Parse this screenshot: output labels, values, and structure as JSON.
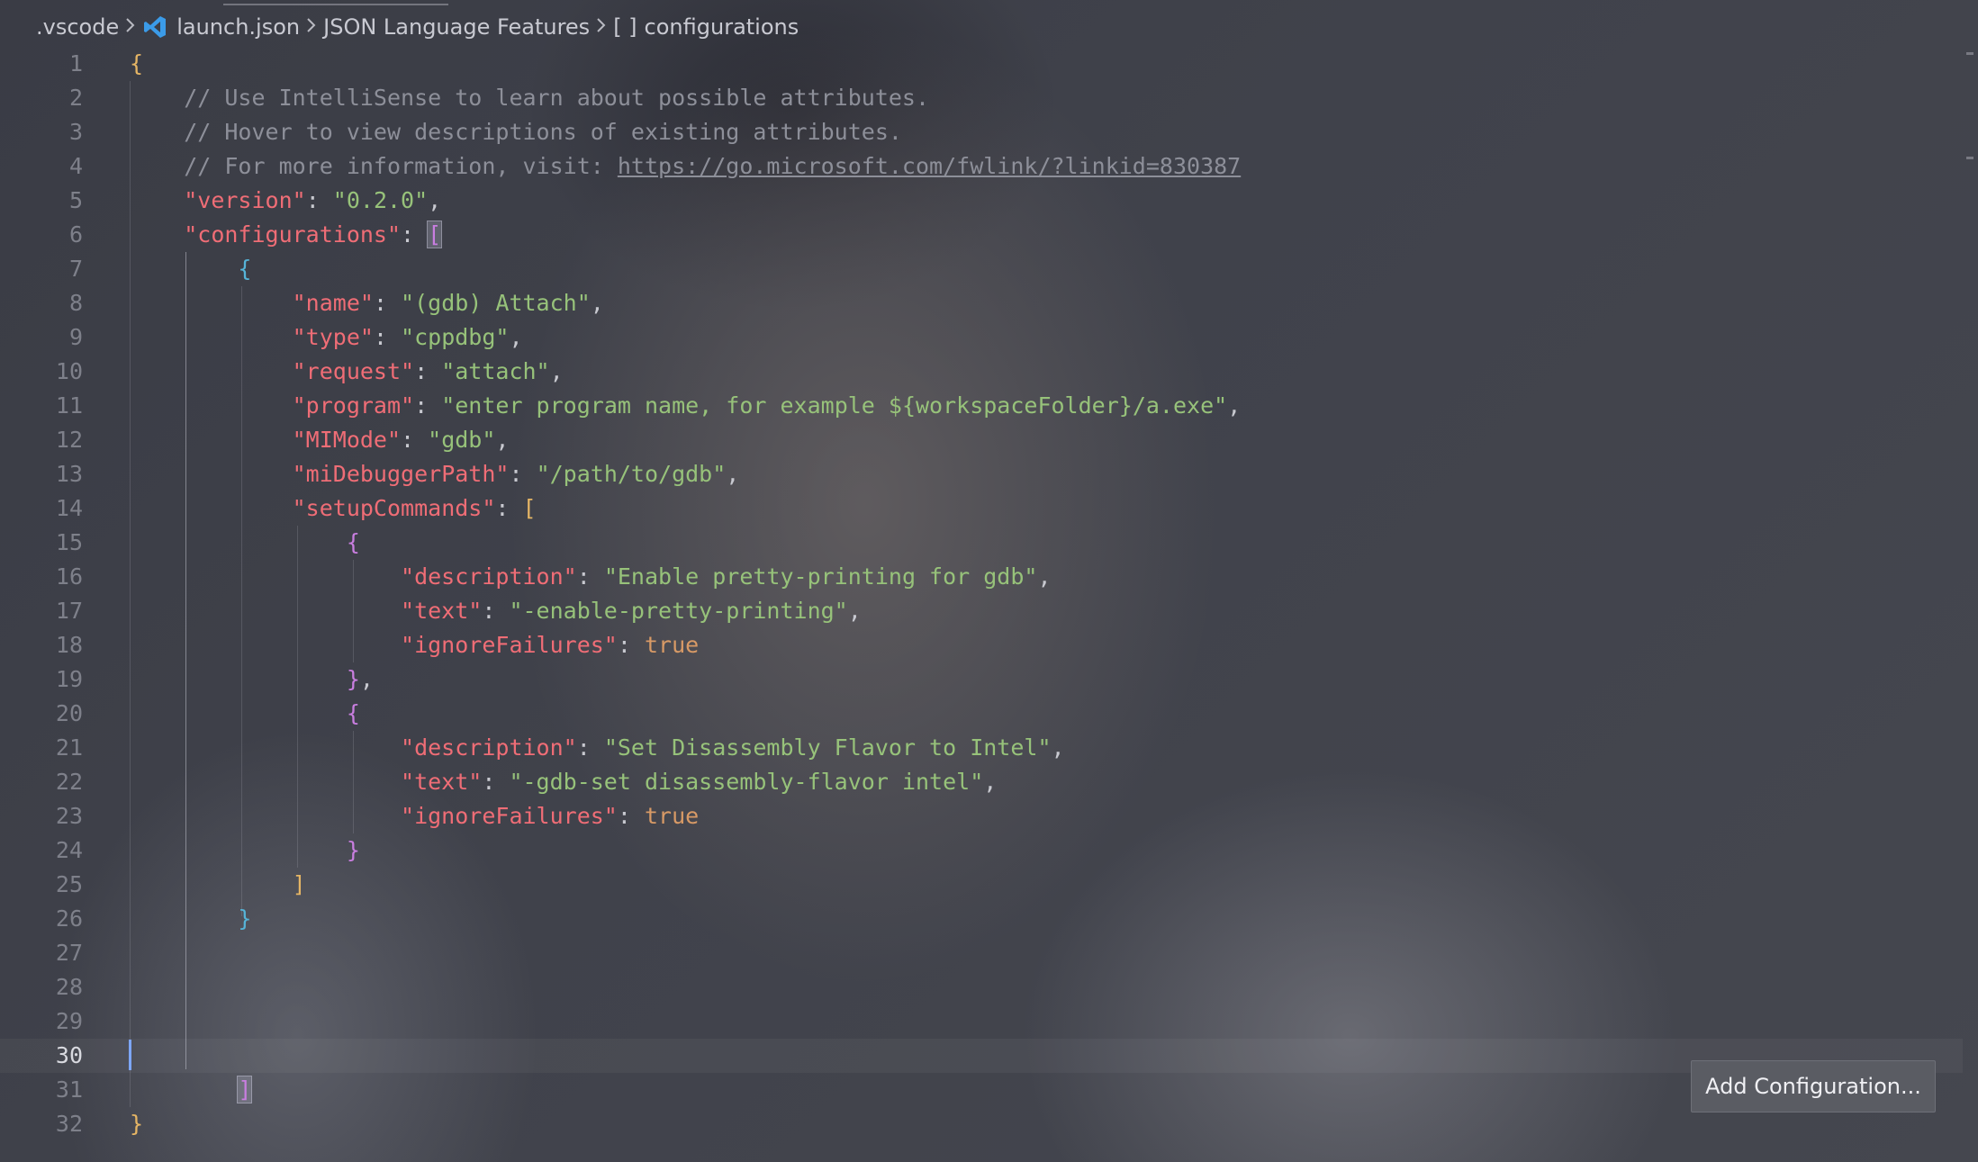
{
  "breadcrumb": {
    "folder": ".vscode",
    "file": "launch.json",
    "feature": "JSON Language Features",
    "symbol_icon": "[ ]",
    "symbol": "configurations"
  },
  "icons": {
    "file_icon": "vscode-logo-icon",
    "chevron": "chevron-right-icon"
  },
  "editor": {
    "current_line": 30,
    "lines": [
      {
        "n": "1"
      },
      {
        "n": "2",
        "comment": "// Use IntelliSense to learn about possible attributes."
      },
      {
        "n": "3",
        "comment": "// Hover to view descriptions of existing attributes."
      },
      {
        "n": "4",
        "comment": "// For more information, visit: ",
        "link": "https://go.microsoft.com/fwlink/?linkid=830387"
      },
      {
        "n": "5",
        "key": "\"version\"",
        "value": "\"0.2.0\""
      },
      {
        "n": "6",
        "key": "\"configurations\""
      },
      {
        "n": "7"
      },
      {
        "n": "8",
        "key": "\"name\"",
        "value": "\"(gdb) Attach\""
      },
      {
        "n": "9",
        "key": "\"type\"",
        "value": "\"cppdbg\""
      },
      {
        "n": "10",
        "key": "\"request\"",
        "value": "\"attach\""
      },
      {
        "n": "11",
        "key": "\"program\"",
        "value": "\"enter program name, for example ${workspaceFolder}/a.exe\""
      },
      {
        "n": "12",
        "key": "\"MIMode\"",
        "value": "\"gdb\""
      },
      {
        "n": "13",
        "key": "\"miDebuggerPath\"",
        "value": "\"/path/to/gdb\""
      },
      {
        "n": "14",
        "key": "\"setupCommands\""
      },
      {
        "n": "15"
      },
      {
        "n": "16",
        "key": "\"description\"",
        "value": "\"Enable pretty-printing for gdb\""
      },
      {
        "n": "17",
        "key": "\"text\"",
        "value": "\"-enable-pretty-printing\""
      },
      {
        "n": "18",
        "key": "\"ignoreFailures\"",
        "value": "true"
      },
      {
        "n": "19"
      },
      {
        "n": "20"
      },
      {
        "n": "21",
        "key": "\"description\"",
        "value": "\"Set Disassembly Flavor to Intel\""
      },
      {
        "n": "22",
        "key": "\"text\"",
        "value": "\"-gdb-set disassembly-flavor intel\""
      },
      {
        "n": "23",
        "key": "\"ignoreFailures\"",
        "value": "true"
      },
      {
        "n": "24"
      },
      {
        "n": "25"
      },
      {
        "n": "26"
      },
      {
        "n": "27"
      },
      {
        "n": "28"
      },
      {
        "n": "29"
      },
      {
        "n": "30"
      },
      {
        "n": "31"
      },
      {
        "n": "32"
      }
    ]
  },
  "buttons": {
    "add_configuration": "Add Configuration..."
  }
}
